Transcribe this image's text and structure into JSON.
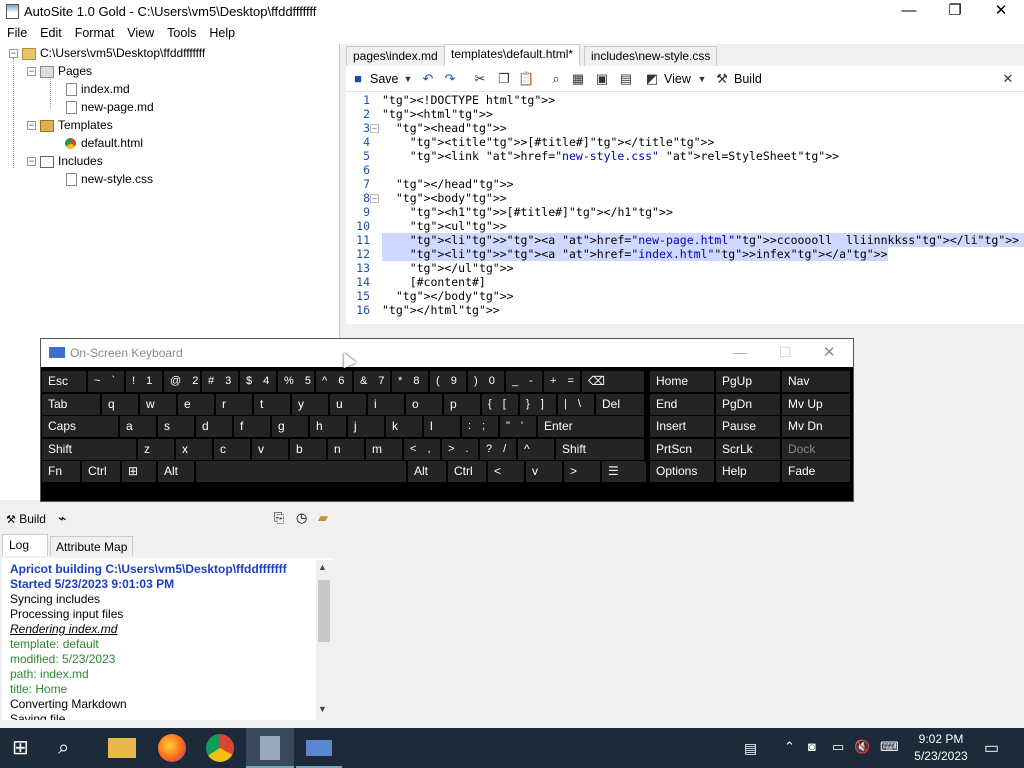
{
  "window": {
    "title": "AutoSite 1.0 Gold - C:\\Users\\vm5\\Desktop\\ffddfffffff",
    "minimize": "—",
    "maximize": "❐",
    "close": "✕"
  },
  "menu": [
    "File",
    "Edit",
    "Format",
    "View",
    "Tools",
    "Help"
  ],
  "tree": {
    "root": "C:\\Users\\vm5\\Desktop\\ffddfffffff",
    "pages_label": "Pages",
    "pages": [
      "index.md",
      "new-page.md"
    ],
    "templates_label": "Templates",
    "templates": [
      "default.html"
    ],
    "includes_label": "Includes",
    "includes": [
      "new-style.css"
    ]
  },
  "tabs": [
    "pages\\index.md",
    "templates\\default.html*",
    "includes\\new-style.css"
  ],
  "toolbar": {
    "save": "Save",
    "view": "View",
    "build": "Build",
    "close": "✕"
  },
  "code": {
    "line_numbers": [
      "1",
      "2",
      "3",
      "4",
      "5",
      "6",
      "7",
      "8",
      "9",
      "10",
      "11",
      "12",
      "13",
      "14",
      "15",
      "16"
    ],
    "lines": [
      "<!DOCTYPE html>",
      "<html>",
      "  <head>",
      "    <title>[#title#]</title>",
      "    <link href=\"new-style.css\" rel=StyleSheet>",
      "",
      "  </head>",
      "  <body>",
      "    <h1>[#title#]</h1>",
      "    <ul>",
      "    <li><a href=\"new-page.html\">ccooooll  lliinnkkss</li>",
      "    <li><a href=\"index.html\">infex</a>",
      "    </ul>",
      "    [#content#]",
      "  </body>",
      "</html>"
    ]
  },
  "osk": {
    "title": "On-Screen Keyboard",
    "rows": [
      [
        "Esc",
        "~ `",
        "! 1",
        "@ 2",
        "# 3",
        "$ 4",
        "% 5",
        "^ 6",
        "& 7",
        "* 8",
        "( 9",
        ") 0",
        "_ -",
        "+ =",
        "⌫",
        "Home",
        "PgUp",
        "Nav"
      ],
      [
        "Tab",
        "q",
        "w",
        "e",
        "r",
        "t",
        "y",
        "u",
        "i",
        "o",
        "p",
        "{ [",
        "} ]",
        "| \\",
        "Del",
        "End",
        "PgDn",
        "Mv Up"
      ],
      [
        "Caps",
        "a",
        "s",
        "d",
        "f",
        "g",
        "h",
        "j",
        "k",
        "l",
        ": ;",
        "\" '",
        "Enter",
        "Insert",
        "Pause",
        "Mv Dn"
      ],
      [
        "Shift",
        "z",
        "x",
        "c",
        "v",
        "b",
        "n",
        "m",
        "< ,",
        "> .",
        "? /",
        "^",
        "Shift",
        "PrtScn",
        "ScrLk",
        "Dock"
      ],
      [
        "Fn",
        "Ctrl",
        "⊞",
        "Alt",
        "",
        "Alt",
        "Ctrl",
        "<",
        "v",
        ">",
        "☰",
        "Options",
        "Help",
        "Fade"
      ]
    ]
  },
  "build_panel": {
    "build_label": "Build",
    "tabs": [
      "Log",
      "Attribute Map"
    ],
    "log": [
      {
        "text": "Apricot building C:\\Users\\vm5\\Desktop\\ffddfffffff",
        "style": "bold-blue"
      },
      {
        "text": "Started 5/23/2023 9:01:03 PM",
        "style": "bold-blue"
      },
      {
        "text": "Syncing includes",
        "style": "normal"
      },
      {
        "text": "Processing input files",
        "style": "normal"
      },
      {
        "text": "Rendering index.md",
        "style": "italic-underline"
      },
      {
        "text": " template: default",
        "style": "green"
      },
      {
        "text": " modified: 5/23/2023",
        "style": "green"
      },
      {
        "text": " path: index.md",
        "style": "green"
      },
      {
        "text": " title: Home",
        "style": "green"
      },
      {
        "text": "Converting Markdown",
        "style": "normal"
      },
      {
        "text": "Saving file",
        "style": "normal"
      }
    ]
  },
  "taskbar": {
    "time": "9:02 PM",
    "date": "5/23/2023"
  },
  "colors": {
    "taskbar": "#1c2a3a",
    "selection": "#cfd8ff",
    "log_blue": "#1a3fc0",
    "log_green": "#2a8a2a"
  }
}
